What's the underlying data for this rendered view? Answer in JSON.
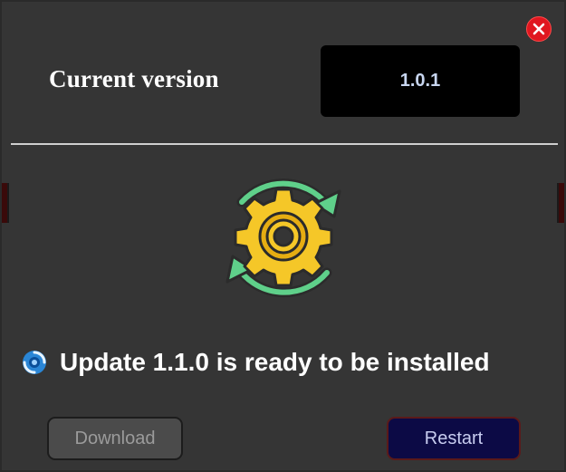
{
  "dialog": {
    "current_version_label": "Current version",
    "current_version_value": "1.0.1",
    "status_message": "Update 1.1.0 is ready to be installed",
    "download_label": "Download",
    "restart_label": "Restart"
  },
  "icons": {
    "close": "close-icon",
    "update_illustration": "gear-sync-icon",
    "status": "update-spinner-icon"
  },
  "colors": {
    "background": "#353535",
    "close_button": "#e0161f",
    "version_box": "#000000",
    "gear": "#f5c728",
    "sync_arrows": "#5fd08a",
    "restart_button": "#0c0a45",
    "download_button": "#4b4b4b"
  },
  "state": {
    "download_enabled": false
  }
}
